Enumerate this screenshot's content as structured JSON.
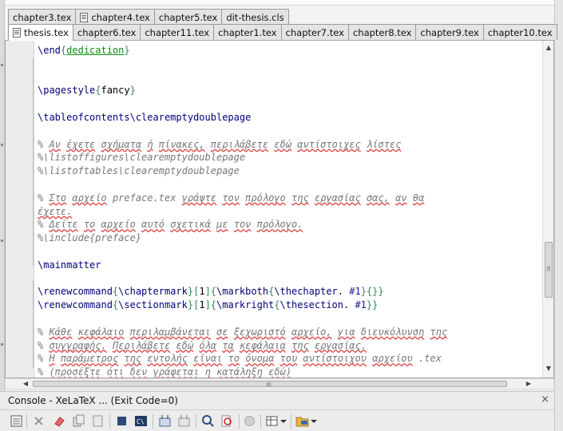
{
  "tabs": {
    "row1": [
      {
        "label": "chapter3.tex",
        "icon": "none"
      },
      {
        "label": "chapter4.tex",
        "icon": "file-icon"
      },
      {
        "label": "chapter5.tex",
        "icon": "none"
      },
      {
        "label": "dit-thesis.cls",
        "icon": "none"
      }
    ],
    "row2": [
      {
        "label": "thesis.tex",
        "icon": "file-icon",
        "active": true
      },
      {
        "label": "chapter6.tex"
      },
      {
        "label": "chapter11.tex"
      },
      {
        "label": "chapter1.tex"
      },
      {
        "label": "chapter7.tex"
      },
      {
        "label": "chapter8.tex"
      },
      {
        "label": "chapter9.tex"
      },
      {
        "label": "chapter10.tex"
      }
    ]
  },
  "editor": {
    "lines": [
      "\\end{dedication}",
      "",
      "",
      "\\pagestyle{fancy}",
      "",
      "\\tableofcontents\\clearemptydoublepage",
      "",
      "% Αν έχετε σχήματα ή πίνακες, περιλάβετε εδώ αντίστοιχες λίστες",
      "%\\listoffigures\\clearemptydoublepage",
      "%\\listoftables\\clearemptydoublepage",
      "",
      "% Στο αρχείο preface.tex γράψτε τον πρόλογο της εργασίας σας, αν θα",
      "έχετε.",
      "% Δείτε το αρχείο αυτό σχετικά με τον πρόλογο.",
      "%\\include{preface}",
      "",
      "\\mainmatter",
      "",
      "\\renewcommand{\\chaptermark}[1]{\\markboth{\\thechapter. #1}{}}",
      "\\renewcommand{\\sectionmark}[1]{\\markright{\\thesection. #1}}",
      "",
      "% Κάθε κεφάλαιο περιλαμβάνεται σε ξεχωριστό αρχείο, για διευκόλυνση της",
      "% συγγραφής. Περιλάβετε εδώ όλα τα κεφάλαια της εργασίας.",
      "% Η παράμετρος της εντολής είναι το όνομα του αντίστοιχου αρχείου .tex",
      "% (προσέξτε ότι δεν γράφεται η κατάληξη εδώ)"
    ]
  },
  "console": {
    "title": "Console - XeLaTeX ... (Exit Code=0)",
    "close": "×"
  },
  "toolbar": {
    "icons": [
      "list-icon",
      "close-x-icon",
      "eraser-icon",
      "copy-icon",
      "page-icon",
      "stop-icon",
      "terminal-icon",
      "grid-icon",
      "grid2-icon",
      "search-icon",
      "find-red-icon",
      "circle-icon",
      "table-icon",
      "dropdown-icon",
      "folder-icon",
      "dropdown-icon"
    ]
  }
}
